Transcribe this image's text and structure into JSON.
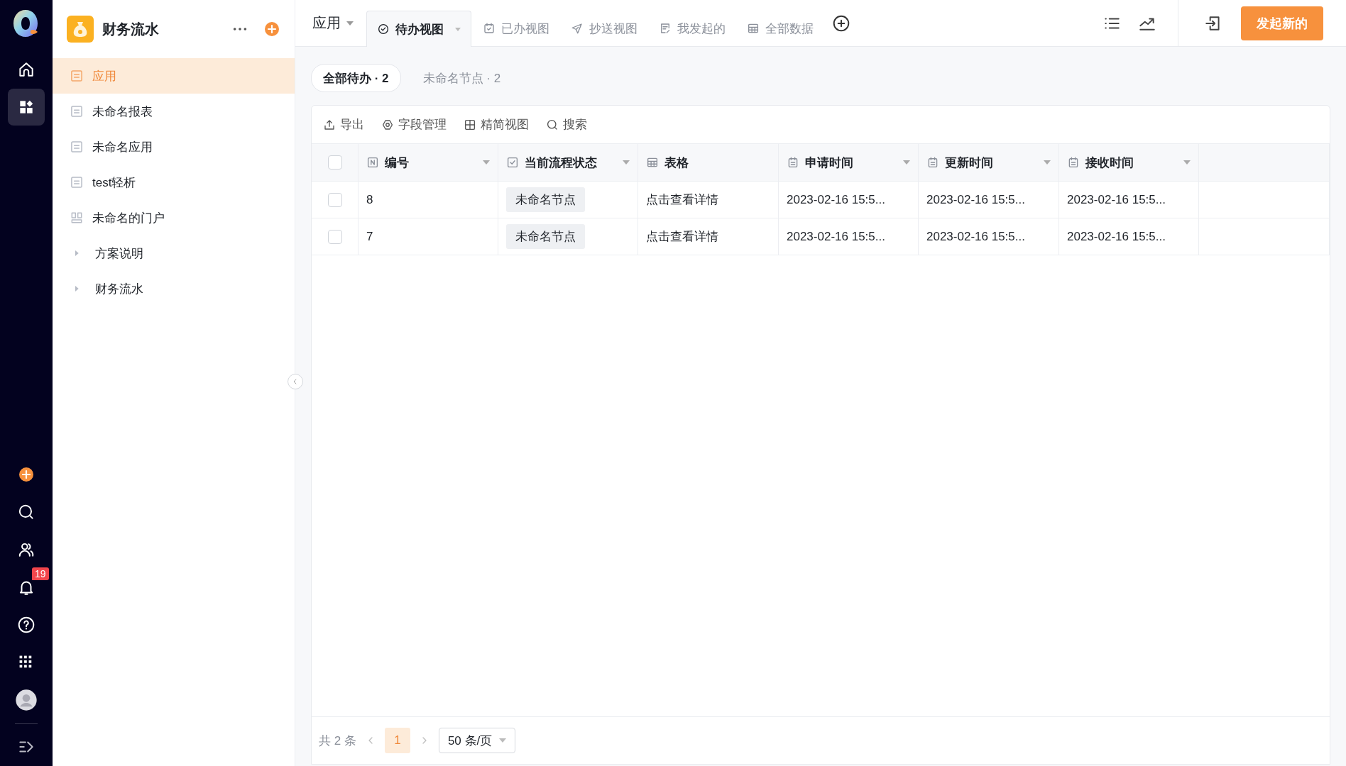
{
  "rail": {
    "top": [
      {
        "kind": "home",
        "selected": false
      },
      {
        "kind": "apps",
        "selected": true
      }
    ],
    "bottom": [
      {
        "kind": "add"
      },
      {
        "kind": "search"
      },
      {
        "kind": "people"
      },
      {
        "kind": "bell",
        "badge": "19"
      },
      {
        "kind": "help"
      },
      {
        "kind": "grid"
      },
      {
        "kind": "avatar"
      },
      {
        "kind": "expand"
      }
    ]
  },
  "sidebar": {
    "title": "财务流水",
    "items": [
      {
        "label": "应用",
        "kind": "page",
        "selected": true
      },
      {
        "label": "未命名报表",
        "kind": "page",
        "selected": false
      },
      {
        "label": "未命名应用",
        "kind": "page",
        "selected": false
      },
      {
        "label": "test轻析",
        "kind": "page",
        "selected": false
      },
      {
        "label": "未命名的门户",
        "kind": "portal",
        "selected": false
      },
      {
        "label": "方案说明",
        "kind": "folder",
        "selected": false
      },
      {
        "label": "财务流水",
        "kind": "folder",
        "selected": false
      }
    ]
  },
  "topbar": {
    "app_menu": "应用",
    "tabs": [
      {
        "label": "待办视图",
        "kind": "todo",
        "selected": true
      },
      {
        "label": "已办视图",
        "kind": "done",
        "selected": false
      },
      {
        "label": "抄送视图",
        "kind": "send",
        "selected": false
      },
      {
        "label": "我发起的",
        "kind": "mine",
        "selected": false
      },
      {
        "label": "全部数据",
        "kind": "table",
        "selected": false
      }
    ],
    "new_button": "发起新的"
  },
  "filters": [
    {
      "label": "全部待办 · 2",
      "selected": true
    },
    {
      "label": "未命名节点 · 2",
      "selected": false
    }
  ],
  "toolbar": [
    {
      "label": "导出",
      "kind": "export"
    },
    {
      "label": "字段管理",
      "kind": "fields"
    },
    {
      "label": "精简视图",
      "kind": "compact"
    },
    {
      "label": "搜索",
      "kind": "search"
    }
  ],
  "table": {
    "select_all": false,
    "columns": [
      {
        "label": "编号",
        "kind": "number",
        "filter": true
      },
      {
        "label": "当前流程状态",
        "kind": "status",
        "filter": true
      },
      {
        "label": "表格",
        "kind": "table",
        "filter": false
      },
      {
        "label": "申请时间",
        "kind": "date",
        "filter": true
      },
      {
        "label": "更新时间",
        "kind": "date",
        "filter": true
      },
      {
        "label": "接收时间",
        "kind": "date",
        "filter": true
      }
    ],
    "rows": [
      {
        "checked": false,
        "cells": [
          "8",
          "未命名节点",
          "点击查看详情",
          "2023-02-16 15:5...",
          "2023-02-16 15:5...",
          "2023-02-16 15:5..."
        ]
      },
      {
        "checked": false,
        "cells": [
          "7",
          "未命名节点",
          "点击查看详情",
          "2023-02-16 15:5...",
          "2023-02-16 15:5...",
          "2023-02-16 15:5..."
        ]
      }
    ]
  },
  "pagination": {
    "total": "共 2 条",
    "pages": [
      {
        "label": "1",
        "selected": true
      }
    ],
    "page_size": "50 条/页"
  }
}
